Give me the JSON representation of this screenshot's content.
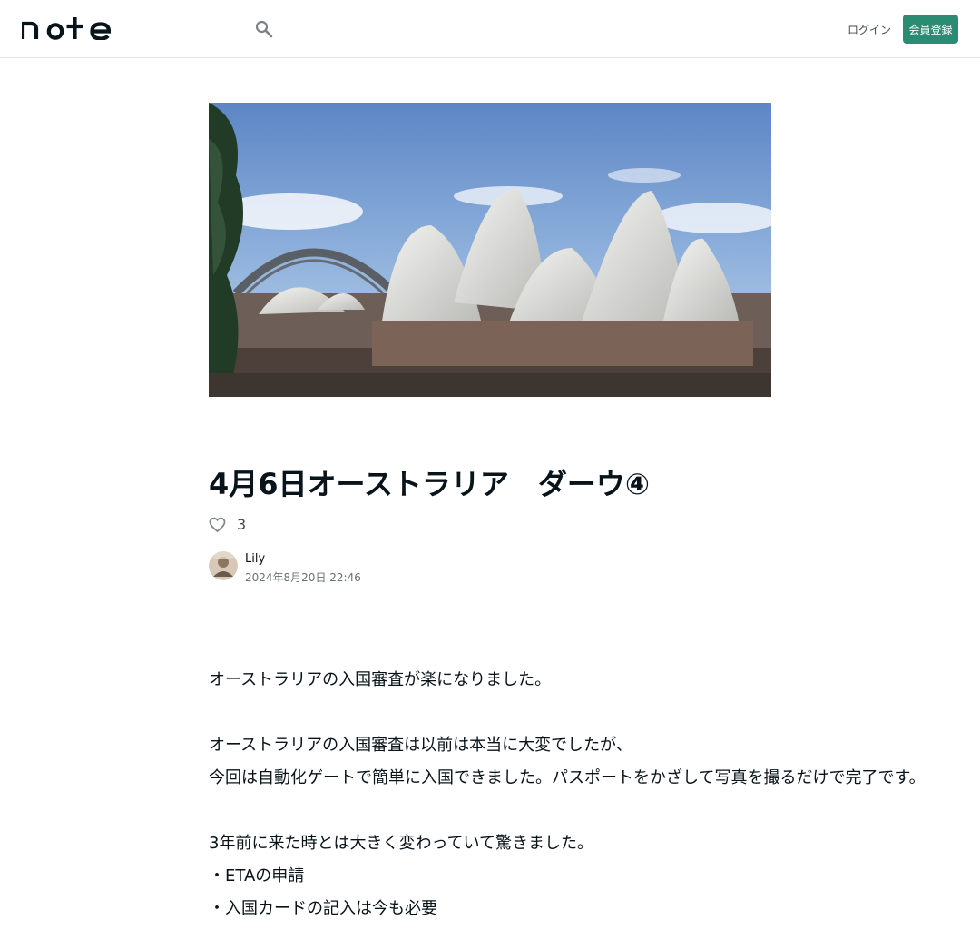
{
  "header": {
    "logo_icon": "note-logo",
    "search_icon": "search-icon",
    "login_label": "ログイン",
    "signup_label": "会員登録",
    "accent_color": "#2a8c72"
  },
  "article": {
    "hero_image": "sydney-opera-house-photo",
    "title": "4月6日オーストラリア　ダーウ④",
    "like_icon": "heart-icon",
    "like_count": "3",
    "author": {
      "name": "Lily",
      "date": "2024年8月20日 22:46"
    },
    "paragraphs": [
      [
        "オーストラリアの入国審査が楽になりました。"
      ],
      [
        "オーストラリアの入国審査は以前は本当に大変でしたが、",
        "今回は自動化ゲートで簡単に入国できました。パスポートをかざして写真を撮るだけで完了です。"
      ],
      [
        "3年前に来た時とは大きく変わっていて驚きました。",
        "・ETAの申請",
        "・入国カードの記入は今も必要"
      ]
    ]
  }
}
